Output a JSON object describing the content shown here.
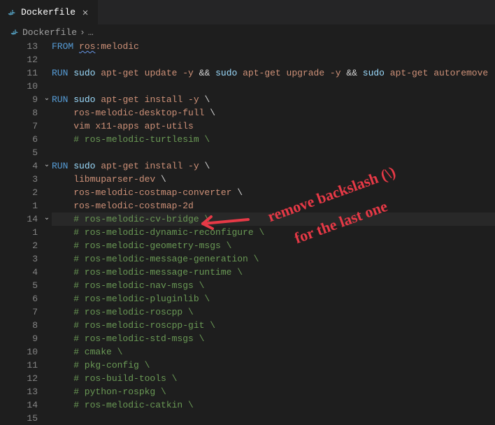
{
  "tab": {
    "icon": "docker-icon",
    "title": "Dockerfile"
  },
  "breadcrumb": {
    "icon": "docker-icon",
    "file": "Dockerfile",
    "more": "…"
  },
  "annotation": {
    "line1": "remove backslash (\\)",
    "line2": "for the last one"
  },
  "lines": [
    {
      "n": "13",
      "fold": "",
      "active": false,
      "segs": [
        {
          "t": "FROM",
          "c": "kw-from"
        },
        {
          "t": " ",
          "c": "op"
        },
        {
          "t": "ros",
          "c": "str squig"
        },
        {
          "t": ":melodic",
          "c": "str"
        }
      ]
    },
    {
      "n": "12",
      "fold": "",
      "active": false,
      "segs": []
    },
    {
      "n": "11",
      "fold": "",
      "active": false,
      "segs": [
        {
          "t": "RUN",
          "c": "kw-run"
        },
        {
          "t": " ",
          "c": "op"
        },
        {
          "t": "sudo",
          "c": "cmd"
        },
        {
          "t": " apt-get update -y ",
          "c": "str"
        },
        {
          "t": "&&",
          "c": "op"
        },
        {
          "t": " ",
          "c": "str"
        },
        {
          "t": "sudo",
          "c": "cmd"
        },
        {
          "t": " apt-get upgrade -y ",
          "c": "str"
        },
        {
          "t": "&&",
          "c": "op"
        },
        {
          "t": " ",
          "c": "str"
        },
        {
          "t": "sudo",
          "c": "cmd"
        },
        {
          "t": " apt-get autoremove",
          "c": "str"
        }
      ]
    },
    {
      "n": "10",
      "fold": "",
      "active": false,
      "segs": []
    },
    {
      "n": "9",
      "fold": "v",
      "active": false,
      "segs": [
        {
          "t": "RUN",
          "c": "kw-run"
        },
        {
          "t": " ",
          "c": "op"
        },
        {
          "t": "sudo",
          "c": "cmd"
        },
        {
          "t": " apt-get install -y ",
          "c": "str"
        },
        {
          "t": "\\",
          "c": "op"
        }
      ]
    },
    {
      "n": "8",
      "fold": "",
      "active": false,
      "segs": [
        {
          "t": "    ros-melodic-desktop-full ",
          "c": "str"
        },
        {
          "t": "\\",
          "c": "op"
        }
      ]
    },
    {
      "n": "7",
      "fold": "",
      "active": false,
      "segs": [
        {
          "t": "    vim x11-apps apt-utils",
          "c": "str"
        }
      ]
    },
    {
      "n": "6",
      "fold": "",
      "active": false,
      "segs": [
        {
          "t": "    # ros-melodic-turtlesim \\",
          "c": "cmt"
        }
      ]
    },
    {
      "n": "5",
      "fold": "",
      "active": false,
      "segs": []
    },
    {
      "n": "4",
      "fold": "v",
      "active": false,
      "segs": [
        {
          "t": "RUN",
          "c": "kw-run"
        },
        {
          "t": " ",
          "c": "op"
        },
        {
          "t": "sudo",
          "c": "cmd"
        },
        {
          "t": " apt-get install -y ",
          "c": "str"
        },
        {
          "t": "\\",
          "c": "op"
        }
      ]
    },
    {
      "n": "3",
      "fold": "",
      "active": false,
      "segs": [
        {
          "t": "    libmuparser-dev ",
          "c": "str"
        },
        {
          "t": "\\",
          "c": "op"
        }
      ]
    },
    {
      "n": "2",
      "fold": "",
      "active": false,
      "segs": [
        {
          "t": "    ros-melodic-costmap-converter ",
          "c": "str"
        },
        {
          "t": "\\",
          "c": "op"
        }
      ]
    },
    {
      "n": "1",
      "fold": "",
      "active": false,
      "segs": [
        {
          "t": "    ros-melodic-costmap-2d",
          "c": "str"
        }
      ]
    },
    {
      "n": "14",
      "fold": "v",
      "active": true,
      "segs": [
        {
          "t": "    # ros-melodic-cv-bridge \\",
          "c": "cmt"
        }
      ]
    },
    {
      "n": "1",
      "fold": "",
      "active": false,
      "segs": [
        {
          "t": "    # ros-melodic-dynamic-reconfigure \\",
          "c": "cmt"
        }
      ]
    },
    {
      "n": "2",
      "fold": "",
      "active": false,
      "segs": [
        {
          "t": "    # ros-melodic-geometry-msgs \\",
          "c": "cmt"
        }
      ]
    },
    {
      "n": "3",
      "fold": "",
      "active": false,
      "segs": [
        {
          "t": "    # ros-melodic-message-generation \\",
          "c": "cmt"
        }
      ]
    },
    {
      "n": "4",
      "fold": "",
      "active": false,
      "segs": [
        {
          "t": "    # ros-melodic-message-runtime \\",
          "c": "cmt"
        }
      ]
    },
    {
      "n": "5",
      "fold": "",
      "active": false,
      "segs": [
        {
          "t": "    # ros-melodic-nav-msgs \\",
          "c": "cmt"
        }
      ]
    },
    {
      "n": "6",
      "fold": "",
      "active": false,
      "segs": [
        {
          "t": "    # ros-melodic-pluginlib \\",
          "c": "cmt"
        }
      ]
    },
    {
      "n": "7",
      "fold": "",
      "active": false,
      "segs": [
        {
          "t": "    # ros-melodic-roscpp \\",
          "c": "cmt"
        }
      ]
    },
    {
      "n": "8",
      "fold": "",
      "active": false,
      "segs": [
        {
          "t": "    # ros-melodic-roscpp-git \\",
          "c": "cmt"
        }
      ]
    },
    {
      "n": "9",
      "fold": "",
      "active": false,
      "segs": [
        {
          "t": "    # ros-melodic-std-msgs \\",
          "c": "cmt"
        }
      ]
    },
    {
      "n": "10",
      "fold": "",
      "active": false,
      "segs": [
        {
          "t": "    # cmake \\",
          "c": "cmt"
        }
      ]
    },
    {
      "n": "11",
      "fold": "",
      "active": false,
      "segs": [
        {
          "t": "    # pkg-config \\",
          "c": "cmt"
        }
      ]
    },
    {
      "n": "12",
      "fold": "",
      "active": false,
      "segs": [
        {
          "t": "    # ros-build-tools \\",
          "c": "cmt"
        }
      ]
    },
    {
      "n": "13",
      "fold": "",
      "active": false,
      "segs": [
        {
          "t": "    # python-rospkg \\",
          "c": "cmt"
        }
      ]
    },
    {
      "n": "14",
      "fold": "",
      "active": false,
      "segs": [
        {
          "t": "    # ros-melodic-catkin \\",
          "c": "cmt"
        }
      ]
    },
    {
      "n": "15",
      "fold": "",
      "active": false,
      "segs": []
    }
  ]
}
